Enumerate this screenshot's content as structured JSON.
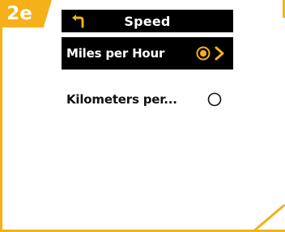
{
  "step": {
    "label": "2e"
  },
  "screen": {
    "title": "Speed",
    "options": [
      {
        "label": "Miles per Hour",
        "selected": true
      },
      {
        "label": "Kilometers per...",
        "selected": false
      }
    ]
  },
  "colors": {
    "accent": "#f5b01a",
    "screen_bg": "#000000",
    "text_light": "#ffffff",
    "text_dark": "#111111"
  },
  "icons": {
    "back": "back-arrow-icon",
    "selected_radio": "radio-selected-icon",
    "next": "chevron-right-icon",
    "empty_radio": "radio-empty-icon"
  }
}
